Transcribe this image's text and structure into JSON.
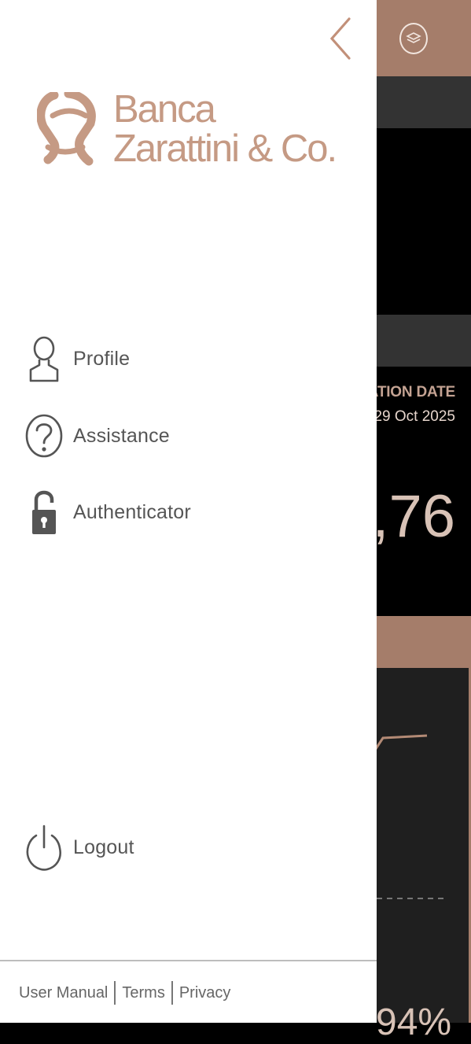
{
  "brand": {
    "line1": "Banca",
    "line2": "Zarattini & Co.",
    "color": "#c59a84"
  },
  "menu": [
    {
      "label": "Profile",
      "icon": "user-icon"
    },
    {
      "label": "Assistance",
      "icon": "question-icon"
    },
    {
      "label": "Authenticator",
      "icon": "lock-icon"
    }
  ],
  "logout": {
    "label": "Logout",
    "icon": "power-icon"
  },
  "footer": {
    "links": [
      "User Manual",
      "Terms",
      "Privacy"
    ]
  },
  "background": {
    "date_label": "ATION DATE",
    "date_value": "29 Oct 2025",
    "big_value": ",76",
    "percent": "94%"
  },
  "colors": {
    "accent": "#a57d6a",
    "drawer_bg": "#ffffff",
    "icon": "#555555"
  }
}
